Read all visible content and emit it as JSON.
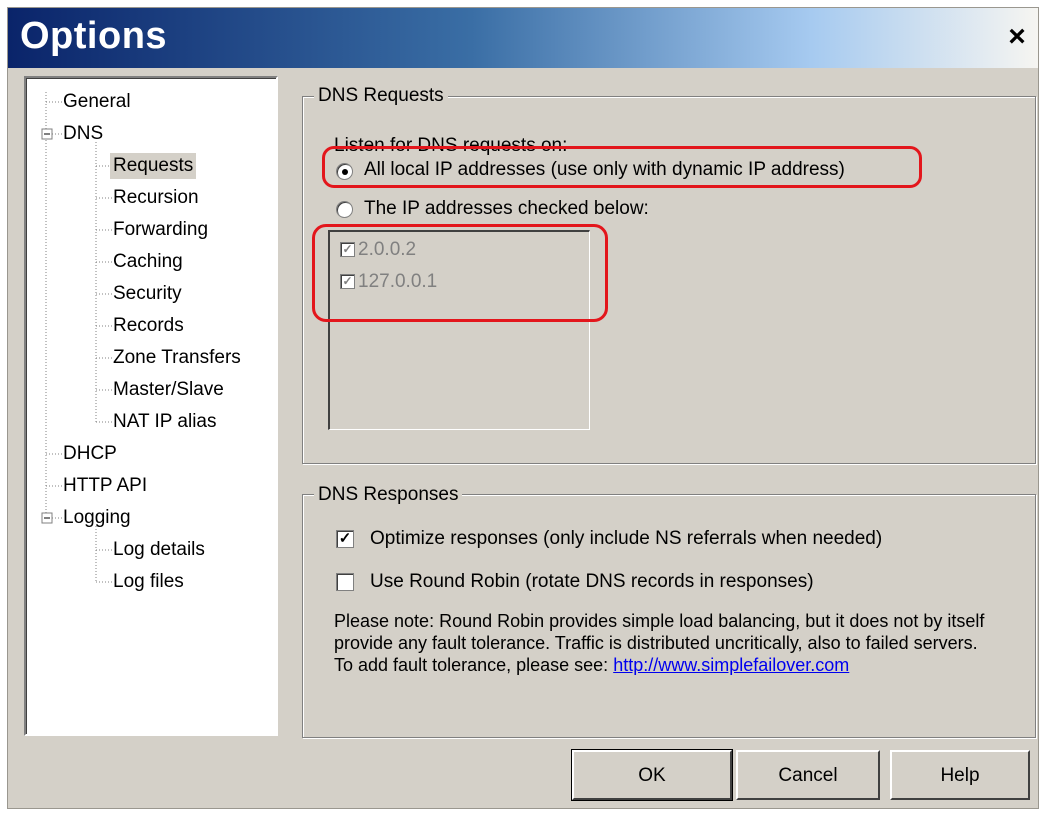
{
  "window": {
    "title": "Options",
    "close_glyph": "×"
  },
  "tree": {
    "items": [
      {
        "label": "General",
        "level": 0
      },
      {
        "label": "DNS",
        "level": 0,
        "expander": "⊟"
      },
      {
        "label": "Requests",
        "level": 1,
        "selected": true
      },
      {
        "label": "Recursion",
        "level": 1
      },
      {
        "label": "Forwarding",
        "level": 1
      },
      {
        "label": "Caching",
        "level": 1
      },
      {
        "label": "Security",
        "level": 1
      },
      {
        "label": "Records",
        "level": 1
      },
      {
        "label": "Zone Transfers",
        "level": 1
      },
      {
        "label": "Master/Slave",
        "level": 1
      },
      {
        "label": "NAT IP alias",
        "level": 1
      },
      {
        "label": "DHCP",
        "level": 0
      },
      {
        "label": "HTTP API",
        "level": 0
      },
      {
        "label": "Logging",
        "level": 0,
        "expander": "⊟"
      },
      {
        "label": "Log details",
        "level": 1
      },
      {
        "label": "Log files",
        "level": 1
      }
    ]
  },
  "dns_requests": {
    "legend": "DNS Requests",
    "listen_label": "Listen for DNS requests on:",
    "option_all": "All local IP addresses  (use only with dynamic IP address)",
    "option_checked": "The IP addresses checked below:",
    "selected_option": "all",
    "ip_list": [
      {
        "ip": "2.0.0.2",
        "checked": true
      },
      {
        "ip": "127.0.0.1",
        "checked": true
      }
    ]
  },
  "dns_responses": {
    "legend": "DNS Responses",
    "optimize_label": "Optimize responses (only include NS referrals when needed)",
    "optimize_checked": true,
    "round_robin_label": "Use Round Robin (rotate DNS records in responses)",
    "round_robin_checked": false,
    "note": "Please note: Round Robin provides simple load balancing, but it does not by itself provide any fault tolerance. Traffic is distributed uncritically, also to failed servers.",
    "fault_prefix": "To add fault tolerance, please see: ",
    "fault_link": "http://www.simplefailover.com"
  },
  "buttons": {
    "ok": "OK",
    "cancel": "Cancel",
    "help": "Help"
  },
  "check_glyph": "✓",
  "colors": {
    "highlight": "#e3161c",
    "link": "#0000ee",
    "dialog_bg": "#d4d0c8",
    "titlebar_start": "#0a246a"
  }
}
